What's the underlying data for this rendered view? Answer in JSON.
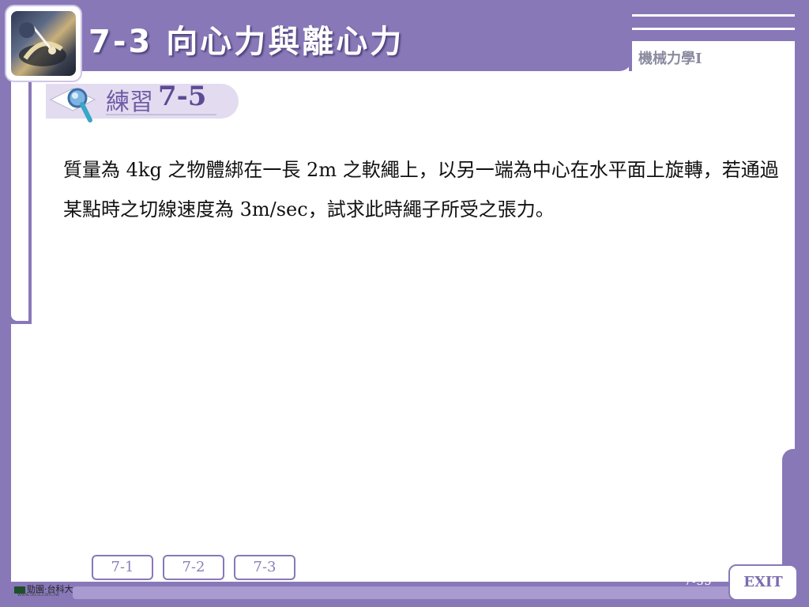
{
  "header": {
    "title": "7-3  向心力與離心力",
    "subject": "機械力學I"
  },
  "exercise": {
    "label": "練習",
    "number": "7-5"
  },
  "question": {
    "text": "質量為 4kg 之物體綁在一長 2m 之軟繩上，以另一端為中心在水平面上旋轉，若通過某點時之切線速度為 3m/sec，試求此時繩子所受之張力。"
  },
  "nav": {
    "buttons": [
      {
        "label": "7-1"
      },
      {
        "label": "7-2"
      },
      {
        "label": "7-3"
      }
    ]
  },
  "footer": {
    "brand": "勁園‧台科大",
    "brand_url": "www.tkcd.com.tw",
    "page": "7-35",
    "exit_label": "EXIT"
  },
  "colors": {
    "frame": "#8878b8",
    "accent": "#5d4a95"
  }
}
